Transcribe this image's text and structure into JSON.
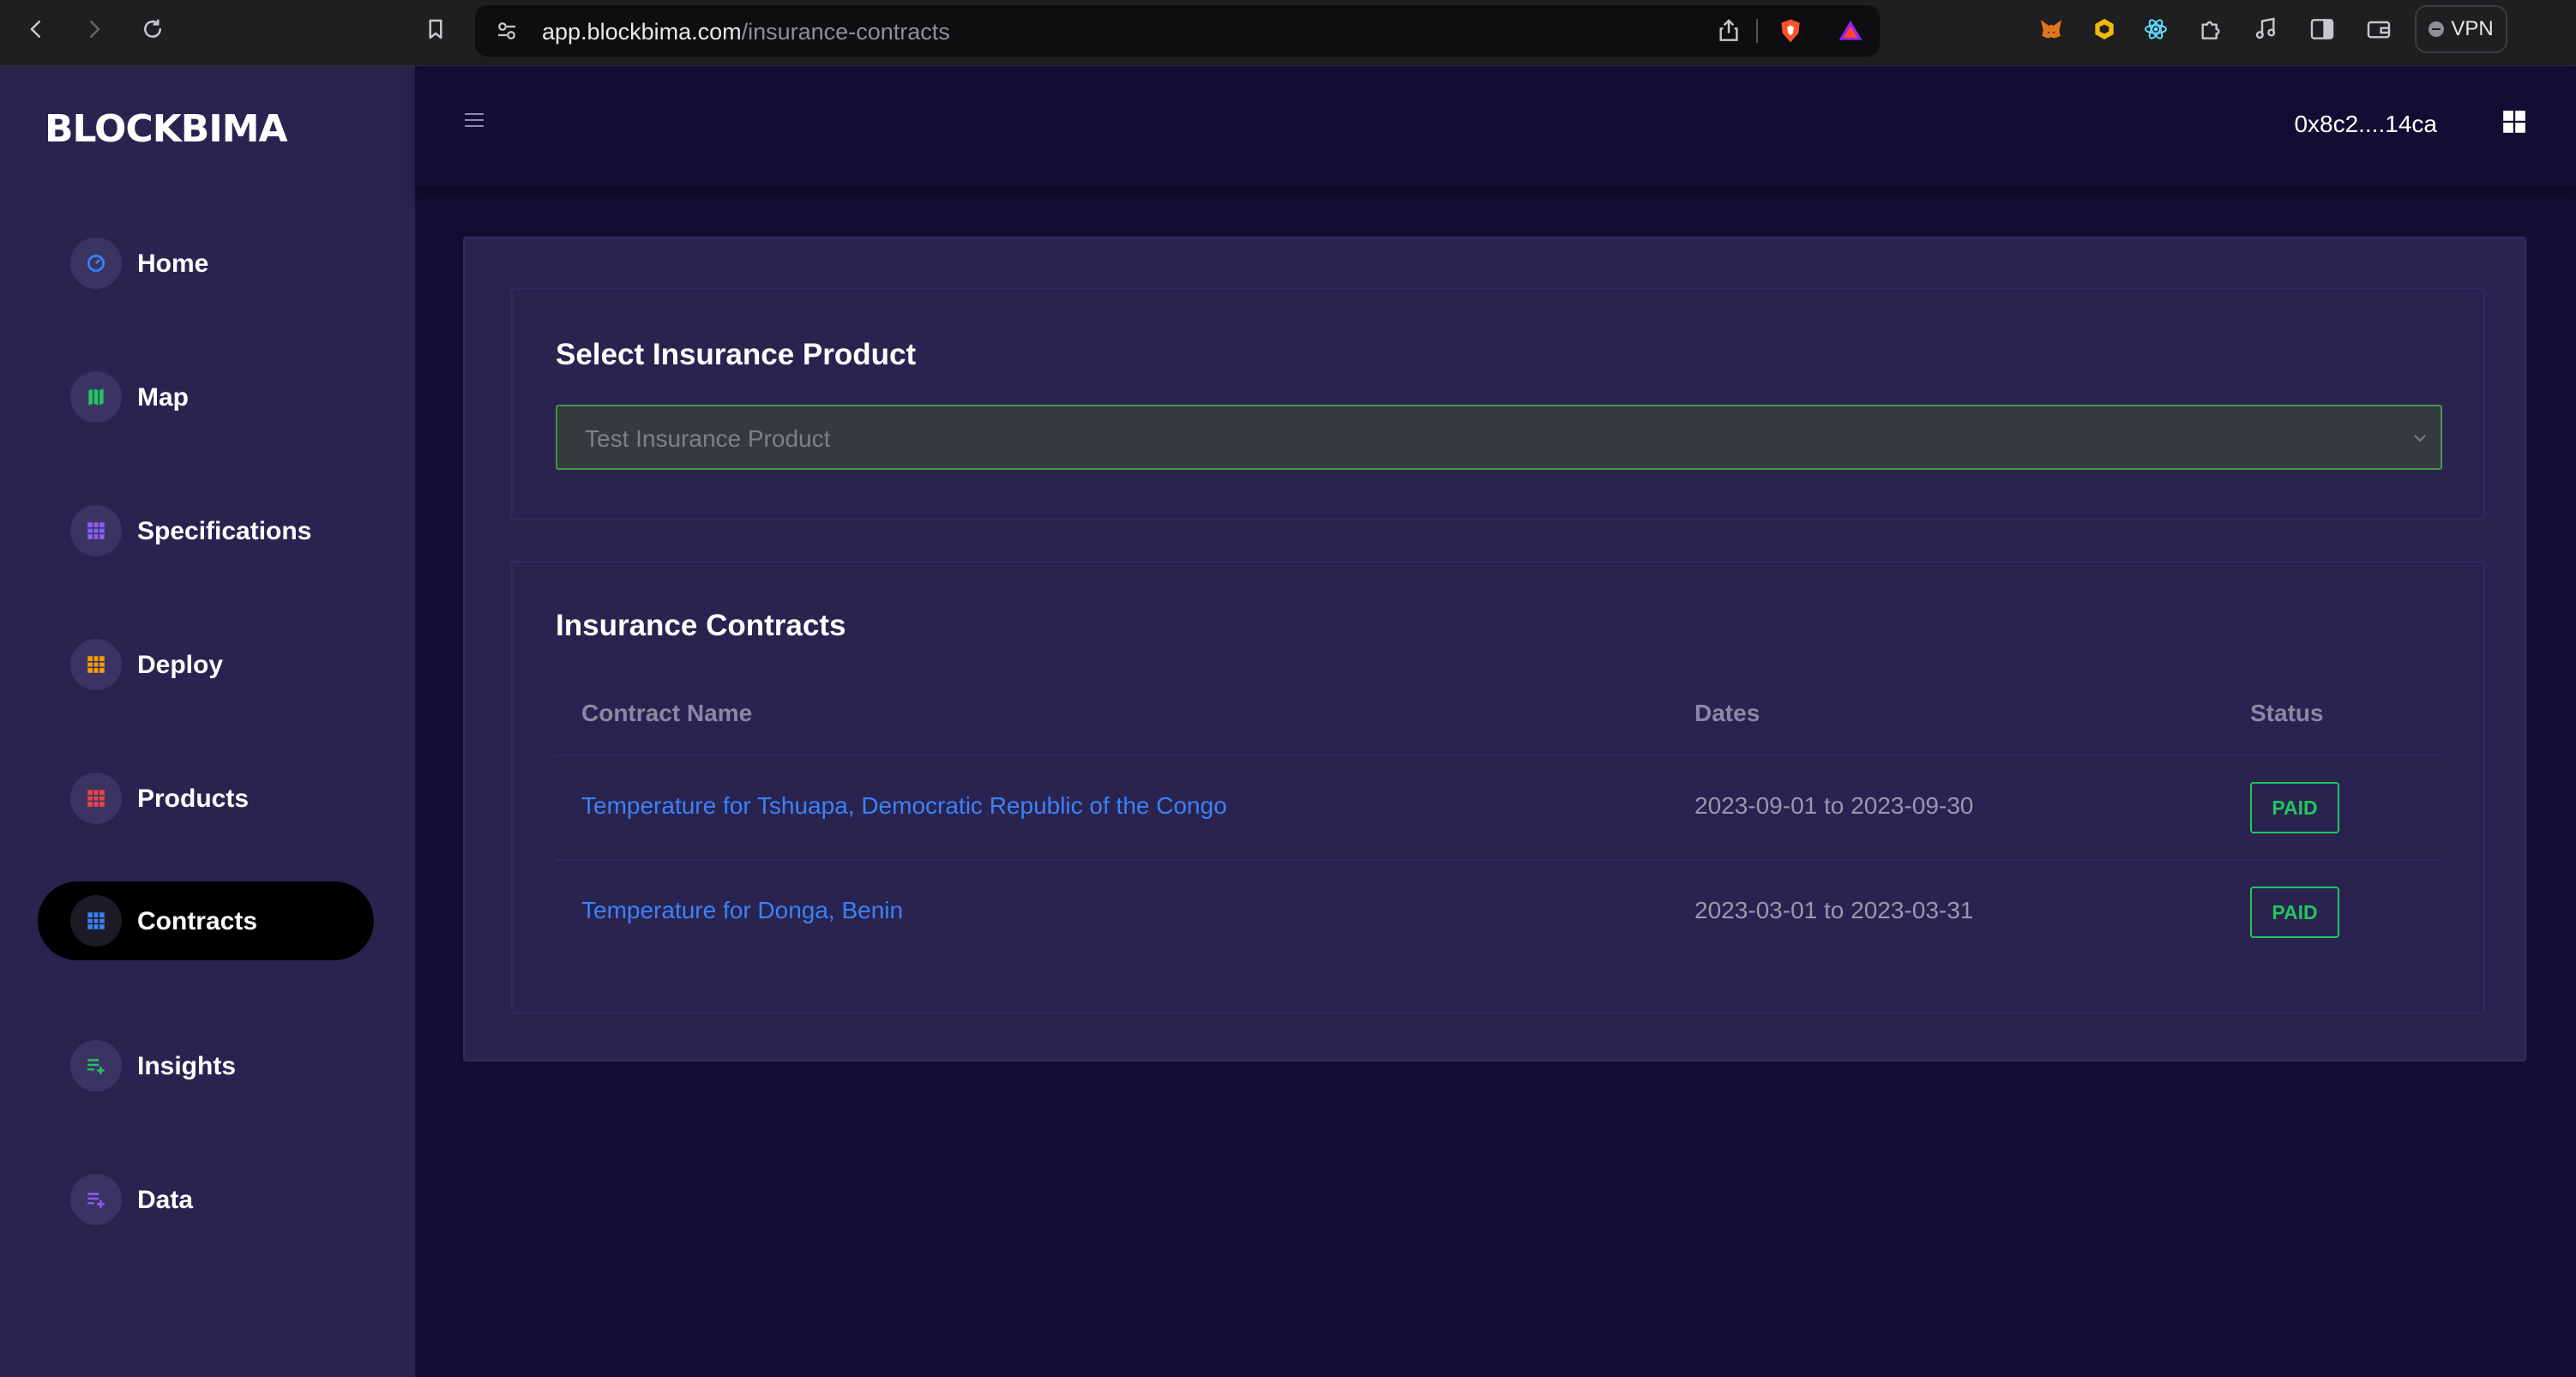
{
  "browser": {
    "url_host": "app.blockbima.com",
    "url_path": "/insurance-contracts",
    "vpn_label": "VPN",
    "icons": [
      "back-icon",
      "forward-icon",
      "reload-icon",
      "bookmark-icon",
      "site-settings-icon",
      "share-icon",
      "brave-shield-icon",
      "brave-rewards-icon",
      "metamask-icon",
      "binance-wallet-icon",
      "react-devtools-icon",
      "extensions-icon",
      "media-icon",
      "sidebar-icon",
      "wallet-icon"
    ]
  },
  "sidebar": {
    "logo": "BLOCKBIMA",
    "items": [
      {
        "label": "Home",
        "icon": "dashboard-gauge-icon",
        "color": "#3b82f6",
        "active": false
      },
      {
        "label": "Map",
        "icon": "map-icon",
        "color": "#22c55e",
        "active": false
      },
      {
        "label": "Specifications",
        "icon": "grid-icon",
        "color": "#8b5cf6",
        "active": false
      },
      {
        "label": "Deploy",
        "icon": "grid-icon",
        "color": "#f59e0b",
        "active": false
      },
      {
        "label": "Products",
        "icon": "grid-icon",
        "color": "#ef4444",
        "active": false
      },
      {
        "label": "Contracts",
        "icon": "grid-icon",
        "color": "#3b82f6",
        "active": true
      },
      {
        "label": "Insights",
        "icon": "list-add-icon",
        "color": "#22c55e",
        "active": false
      },
      {
        "label": "Data",
        "icon": "list-add-icon",
        "color": "#8b5cf6",
        "active": false
      }
    ]
  },
  "header": {
    "wallet_address": "0x8c2....14ca"
  },
  "product_select": {
    "title": "Select Insurance Product",
    "value": "Test Insurance Product"
  },
  "contracts": {
    "title": "Insurance Contracts",
    "columns": [
      "Contract Name",
      "Dates",
      "Status"
    ],
    "rows": [
      {
        "name": "Temperature for Tshuapa, Democratic Republic of the Congo",
        "dates": "2023-09-01 to 2023-09-30",
        "status": "PAID"
      },
      {
        "name": "Temperature for Donga, Benin",
        "dates": "2023-03-01 to 2023-03-31",
        "status": "PAID"
      }
    ]
  },
  "colors": {
    "sidebar_bg": "#2a2350",
    "page_bg": "#140d33",
    "link": "#3b82f6",
    "paid": "#22c55e",
    "select_border": "#3f9a43"
  }
}
